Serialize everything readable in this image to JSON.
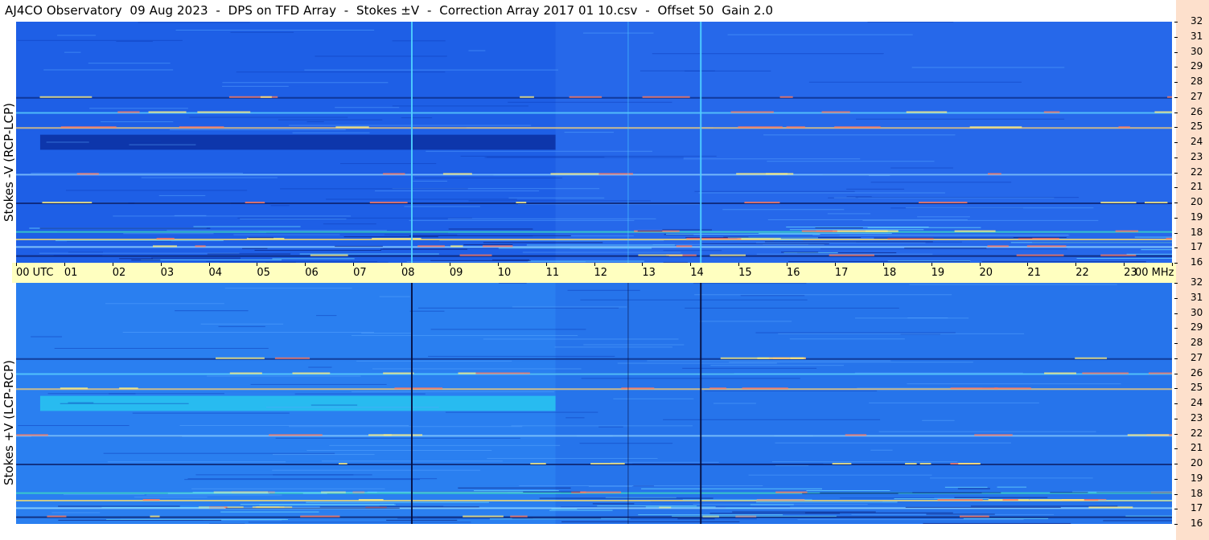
{
  "title": "AJ4CO Observatory  09 Aug 2023  -  DPS on TFD Array  -  Stokes ±V  -  Correction Array 2017 01 10.csv  -  Offset 50  Gain 2.0",
  "colors": {
    "background": "#ffffff",
    "time_axis_bg": "#ffffc0",
    "freq_axis_bg": "#fde0cc",
    "top_base": "#1e5fe6",
    "bottom_base": "#2a7ff0"
  },
  "chart_data": [
    {
      "type": "heatmap",
      "ylabel": "Stokes -V (RCP-LCP)",
      "x_tick_labels": [
        "00 UTC",
        "01",
        "02",
        "03",
        "04",
        "05",
        "06",
        "07",
        "08",
        "09",
        "10",
        "11",
        "12",
        "13",
        "14",
        "15",
        "16",
        "17",
        "18",
        "19",
        "20",
        "21",
        "22",
        "23",
        "00 MHz"
      ],
      "x_unit": "UTC",
      "xlim": [
        0,
        24
      ],
      "y_ticks": [
        "32",
        "31",
        "30",
        "29",
        "28",
        "27",
        "26",
        "25",
        "24",
        "23",
        "22",
        "21",
        "20",
        "19",
        "18",
        "17",
        "16"
      ],
      "y_unit": "MHz",
      "ylim": [
        16,
        32
      ],
      "features": {
        "dark_band_MHz": [
          23.5,
          24.5
        ],
        "dark_band_hours": [
          0.5,
          11.2
        ],
        "background_change_hour": 11.2,
        "vertical_spikes_hours": [
          8.2,
          12.7,
          14.2
        ],
        "interference_lines_MHz": [
          16.5,
          17.1,
          17.6,
          18.1,
          20.0,
          21.9,
          25.0,
          26.0,
          27.0
        ]
      }
    },
    {
      "type": "heatmap",
      "ylabel": "Stokes +V (LCP-RCP)",
      "x_tick_labels": [
        "00 UTC",
        "01",
        "02",
        "03",
        "04",
        "05",
        "06",
        "07",
        "08",
        "09",
        "10",
        "11",
        "12",
        "13",
        "14",
        "15",
        "16",
        "17",
        "18",
        "19",
        "20",
        "21",
        "22",
        "23",
        "00 MHz"
      ],
      "x_unit": "UTC",
      "xlim": [
        0,
        24
      ],
      "y_ticks": [
        "32",
        "31",
        "30",
        "29",
        "28",
        "27",
        "26",
        "25",
        "24",
        "23",
        "22",
        "21",
        "20",
        "19",
        "18",
        "17",
        "16"
      ],
      "y_unit": "MHz",
      "ylim": [
        16,
        32
      ],
      "features": {
        "bright_band_MHz": [
          23.5,
          24.5
        ],
        "bright_band_hours": [
          0.5,
          11.2
        ],
        "background_change_hour": 11.2,
        "vertical_dark_lines_hours": [
          8.2,
          12.7,
          14.2
        ],
        "interference_lines_MHz": [
          16.5,
          17.1,
          17.6,
          18.1,
          20.0,
          21.9,
          25.0,
          26.0,
          27.0
        ]
      }
    }
  ]
}
